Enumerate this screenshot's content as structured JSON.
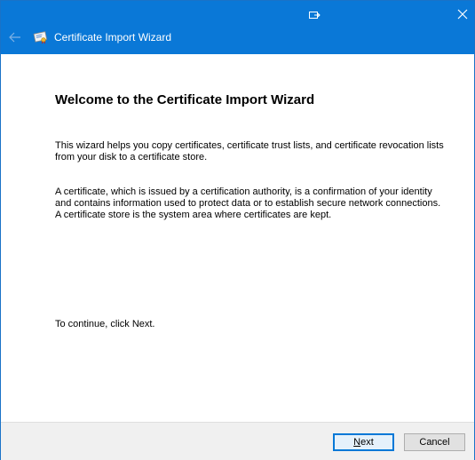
{
  "window": {
    "title": "Certificate Import Wizard",
    "title_bar_color": "#0a78d7",
    "controls": {
      "restore_icon": "restore-icon",
      "close_icon": "close-icon"
    }
  },
  "content": {
    "heading": "Welcome to the Certificate Import Wizard",
    "paragraph1": "This wizard helps you copy certificates, certificate trust lists, and certificate revocation lists from your disk to a certificate store.",
    "paragraph2": "A certificate, which is issued by a certification authority, is a confirmation of your identity and contains information used to protect data or to establish secure network connections. A certificate store is the system area where certificates are kept.",
    "paragraph3": "To continue, click Next."
  },
  "footer": {
    "next_mnemonic": "N",
    "next_rest": "ext",
    "cancel_label": "Cancel"
  }
}
